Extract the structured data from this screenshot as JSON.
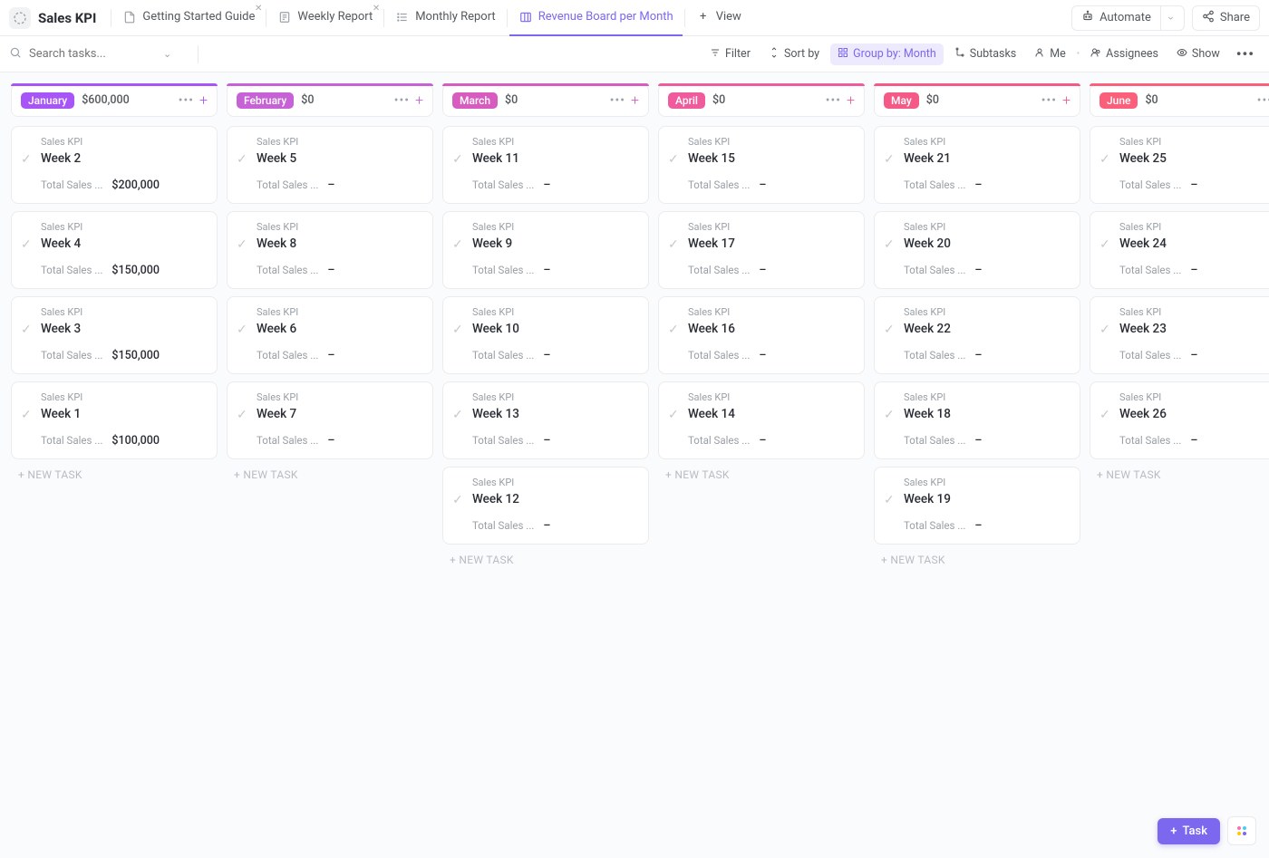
{
  "header": {
    "space_title": "Sales KPI",
    "tabs": [
      {
        "label": "Getting Started Guide",
        "icon": "doc",
        "closable": true
      },
      {
        "label": "Weekly Report",
        "icon": "sheet",
        "closable": true
      },
      {
        "label": "Monthly Report",
        "icon": "list",
        "closable": false
      },
      {
        "label": "Revenue Board per Month",
        "icon": "board",
        "closable": false,
        "active": true
      }
    ],
    "add_view_label": "View",
    "automate_label": "Automate",
    "share_label": "Share"
  },
  "filterbar": {
    "search_placeholder": "Search tasks...",
    "filter_label": "Filter",
    "sort_label": "Sort by",
    "group_label": "Group by: Month",
    "subtasks_label": "Subtasks",
    "me_label": "Me",
    "assignees_label": "Assignees",
    "show_label": "Show"
  },
  "board": {
    "field_label": "Total Sales ...",
    "space_label": "Sales KPI",
    "new_task_label": "+ NEW TASK",
    "columns": [
      {
        "month": "January",
        "color": "#a855f7",
        "total": "$600,000",
        "cards": [
          {
            "title": "Week 2",
            "value": "$200,000"
          },
          {
            "title": "Week 4",
            "value": "$150,000"
          },
          {
            "title": "Week 3",
            "value": "$150,000"
          },
          {
            "title": "Week 1",
            "value": "$100,000"
          }
        ]
      },
      {
        "month": "February",
        "color": "#c661d6",
        "total": "$0",
        "cards": [
          {
            "title": "Week 5",
            "value": "–"
          },
          {
            "title": "Week 8",
            "value": "–"
          },
          {
            "title": "Week 6",
            "value": "–"
          },
          {
            "title": "Week 7",
            "value": "–"
          }
        ]
      },
      {
        "month": "March",
        "color": "#d85bc0",
        "total": "$0",
        "cards": [
          {
            "title": "Week 11",
            "value": "–"
          },
          {
            "title": "Week 9",
            "value": "–"
          },
          {
            "title": "Week 10",
            "value": "–"
          },
          {
            "title": "Week 13",
            "value": "–"
          },
          {
            "title": "Week 12",
            "value": "–"
          }
        ]
      },
      {
        "month": "April",
        "color": "#ef5b9c",
        "total": "$0",
        "cards": [
          {
            "title": "Week 15",
            "value": "–"
          },
          {
            "title": "Week 17",
            "value": "–"
          },
          {
            "title": "Week 16",
            "value": "–"
          },
          {
            "title": "Week 14",
            "value": "–"
          }
        ]
      },
      {
        "month": "May",
        "color": "#f55a87",
        "total": "$0",
        "cards": [
          {
            "title": "Week 21",
            "value": "–"
          },
          {
            "title": "Week 20",
            "value": "–"
          },
          {
            "title": "Week 22",
            "value": "–"
          },
          {
            "title": "Week 18",
            "value": "–"
          },
          {
            "title": "Week 19",
            "value": "–"
          }
        ]
      },
      {
        "month": "June",
        "color": "#fb5f7a",
        "total": "$0",
        "cards": [
          {
            "title": "Week 25",
            "value": "–"
          },
          {
            "title": "Week 24",
            "value": "–"
          },
          {
            "title": "Week 23",
            "value": "–"
          },
          {
            "title": "Week 26",
            "value": "–"
          }
        ]
      }
    ]
  },
  "footer": {
    "task_button_label": "Task"
  }
}
